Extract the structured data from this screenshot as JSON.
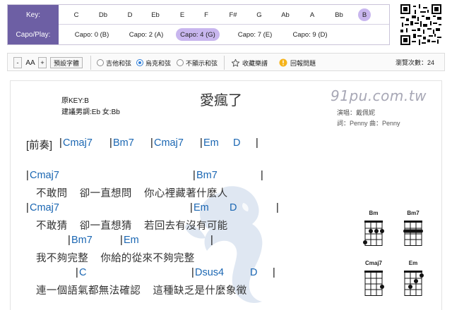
{
  "key_table": {
    "key_label": "Key:",
    "capo_label": "Capo/Play:",
    "keys": [
      "C",
      "Db",
      "D",
      "Eb",
      "E",
      "F",
      "F#",
      "G",
      "Ab",
      "A",
      "Bb",
      "B"
    ],
    "selected_key": "B",
    "capos": [
      "Capo: 0 (B)",
      "Capo: 2 (A)",
      "Capo: 4 (G)",
      "Capo: 7 (E)",
      "Capo: 9 (D)"
    ],
    "selected_capo": "Capo: 4 (G)",
    "highlight_color": "#c8b6ee",
    "label_bg_color": "#6d5fa4"
  },
  "toolbar": {
    "minus_label": "-",
    "font_size_label": "AA",
    "plus_label": "+",
    "default_font_label": "預設字體",
    "options": [
      "吉他和弦",
      "烏克和弦",
      "不顯示和弦"
    ],
    "selected_option": "烏克和弦",
    "favorite_label": "收藏樂譜",
    "report_label": "回報問題",
    "views_label": "瀏覽次數：24"
  },
  "song": {
    "original_key": "原KEY:B",
    "suggested_key": "建議男調:Eb 女:Bb",
    "title": "愛瘋了",
    "site_brand": "91pu.com.tw",
    "singer": "演唱：戴佩妮",
    "credits": "詞：Penny   曲：Penny",
    "chord_color": "#1b67b3"
  },
  "sheet": {
    "intro_label": "[前奏]",
    "intro_chords": [
      "Cmaj7",
      "Bm7",
      "Cmaj7",
      "Em",
      "D"
    ],
    "line1_chords": [
      "Cmaj7",
      "Bm7"
    ],
    "line1_lyric": "不敢問    卻一直想問    你心裡藏著什麼人",
    "line2_chords": [
      "Cmaj7",
      "Em",
      "D"
    ],
    "line2_lyric": "不敢猜    卻一直想猜    若回去有沒有可能",
    "line3_chords": [
      "Bm7",
      "Em"
    ],
    "line3_lyric": "我不夠完整    你給的從來不夠完整",
    "line4_chords": [
      "C",
      "Dsus4",
      "D"
    ],
    "line4_lyric": "連一個語氣都無法確認    這種缺乏是什麼象徵"
  },
  "chord_diagrams": [
    {
      "name": "Bm"
    },
    {
      "name": "Bm7"
    },
    {
      "name": "Cmaj7"
    },
    {
      "name": "Em"
    }
  ]
}
